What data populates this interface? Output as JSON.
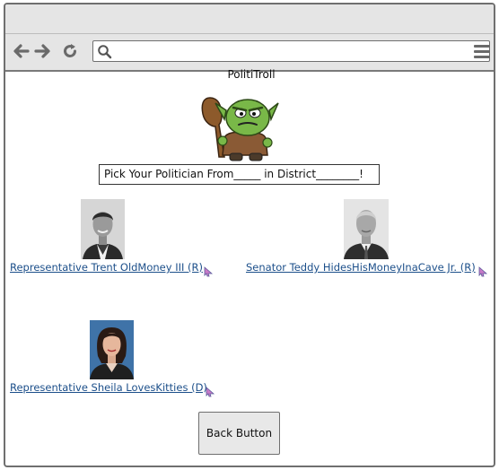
{
  "browser": {
    "address_value": "",
    "icons": [
      "back-arrow-icon",
      "forward-arrow-icon",
      "refresh-icon",
      "search-icon",
      "hamburger-menu-icon"
    ]
  },
  "page": {
    "title": "PolitiTroll",
    "prompt": "Pick Your Politician From_____ in District________!",
    "mascot_icon": "troll-mascot"
  },
  "politicians": [
    {
      "label": "Representative Trent OldMoney III (R)"
    },
    {
      "label": "Senator Teddy HidesHisMoneyInaCave Jr. (R)"
    },
    {
      "label": "Representative Sheila LovesKitties (D)"
    }
  ],
  "back_button": {
    "label": "Back Button"
  },
  "colors": {
    "link": "#1c4f8a",
    "chrome": "#e5e5e5",
    "mascot_green": "#79b848"
  }
}
